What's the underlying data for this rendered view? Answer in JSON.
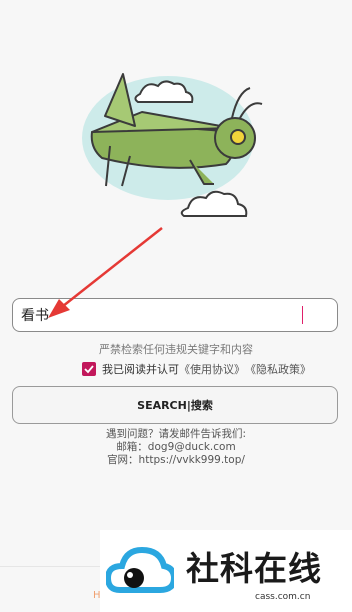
{
  "search": {
    "value": "看书",
    "button_label": "SEARCH|搜索"
  },
  "notice": "严禁检索任何违规关键字和内容",
  "agreement": {
    "prefix": "我已阅读并认可",
    "terms_link": "《使用协议》",
    "privacy_link": "《隐私政策》",
    "checked": true
  },
  "contact": {
    "line1": "遇到问题？请发邮件告诉我们:",
    "line2": "邮箱：dog9@duck.com",
    "line3": "官网：https://vvkk999.top/"
  },
  "watermark": {
    "title": "社科在线",
    "url": "cass.com.cn"
  },
  "bottom_fragment": "H",
  "colors": {
    "accent": "#c2185b",
    "arrow": "#e53935",
    "grasshopper": "#8db35a",
    "cloud_bg": "#cdebea"
  },
  "icons": {
    "hero": "grasshopper-illustration",
    "check": "check-icon",
    "logo": "cloud-eye-icon"
  }
}
